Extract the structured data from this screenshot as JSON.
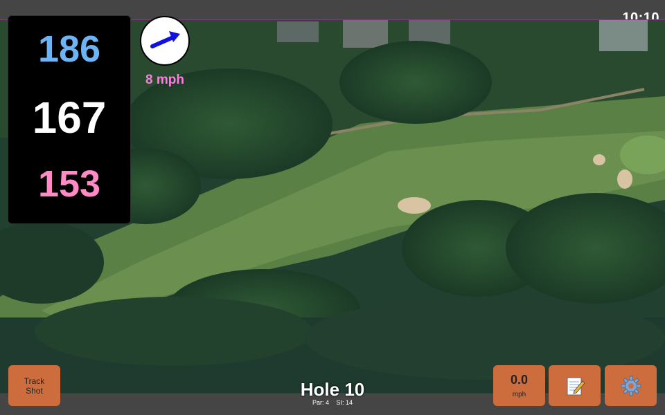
{
  "status_bar": {
    "time": "10:10"
  },
  "yardage": {
    "back": "186",
    "middle": "167",
    "front": "153",
    "colors": {
      "back": "#6cb4f4",
      "middle": "#ffffff",
      "front": "#ff8ac6"
    }
  },
  "wind": {
    "speed_label": "8 mph",
    "direction": "east-north-east",
    "icon": "wind-arrow-icon",
    "arrow_color": "#1010e0",
    "label_color": "#ff7de0"
  },
  "map": {
    "type": "satellite-hole-view"
  },
  "hole": {
    "title": "Hole 10",
    "par": "Par: 4",
    "stroke_index": "SI: 14"
  },
  "buttons": {
    "track_shot": {
      "line1": "Track",
      "line2": "Shot"
    },
    "speed": {
      "value": "0.0",
      "unit": "mph"
    },
    "notes": {
      "icon": "notepad-icon"
    },
    "settings": {
      "icon": "gear-icon"
    }
  },
  "accent_color": "#cd6d3e"
}
